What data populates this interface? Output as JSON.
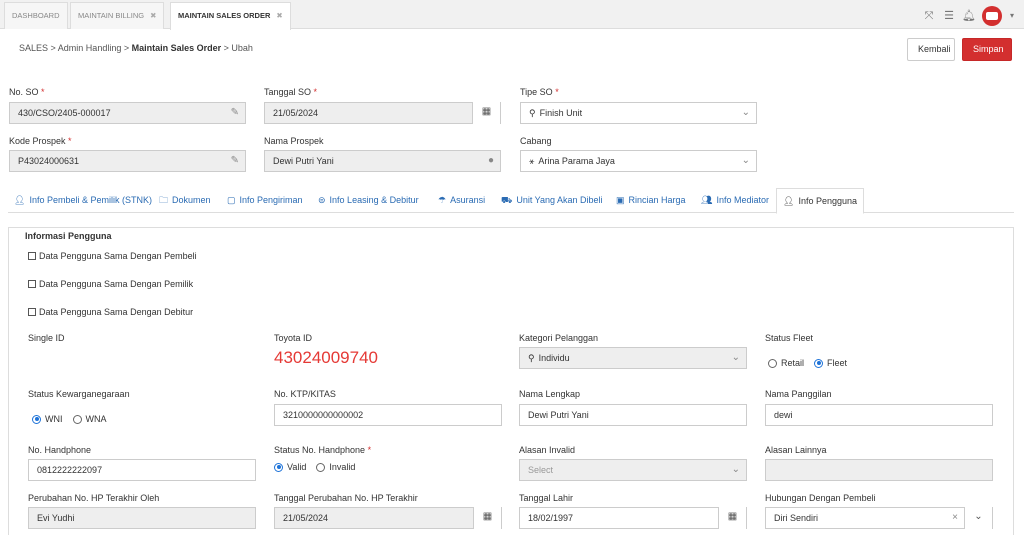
{
  "tabs": [
    {
      "label": "DASHBOARD"
    },
    {
      "label": "MAINTAIN BILLING"
    },
    {
      "label": "MAINTAIN SALES ORDER"
    }
  ],
  "breadcrumb": {
    "part1": "SALES",
    "part2": "Admin Handling",
    "part3": "Maintain Sales Order",
    "part4": "Ubah"
  },
  "actions": {
    "back": "Kembali",
    "save": "Simpan"
  },
  "header": {
    "no_so": {
      "label": "No. SO",
      "value": "430/CSO/2405-000017"
    },
    "tanggal_so": {
      "label": "Tanggal SO",
      "value": "21/05/2024"
    },
    "tipe_so": {
      "label": "Tipe SO",
      "value": "Finish Unit"
    },
    "kode_prospek": {
      "label": "Kode Prospek",
      "value": "P43024000631"
    },
    "nama_prospek": {
      "label": "Nama Prospek",
      "value": "Dewi Putri Yani"
    },
    "cabang": {
      "label": "Cabang",
      "value": "Arina Parama Jaya"
    }
  },
  "navtabs": [
    {
      "label": "Info Pembeli & Pemilik (STNK)",
      "icon": "user-icon"
    },
    {
      "label": "Dokumen",
      "icon": "folder-icon"
    },
    {
      "label": "Info Pengiriman",
      "icon": "map-icon"
    },
    {
      "label": "Info Leasing & Debitur",
      "icon": "money-icon"
    },
    {
      "label": "Asuransi",
      "icon": "umbrella-icon"
    },
    {
      "label": "Unit Yang Akan Dibeli",
      "icon": "car-icon"
    },
    {
      "label": "Rincian Harga",
      "icon": "price-icon"
    },
    {
      "label": "Info Mediator",
      "icon": "users-icon"
    },
    {
      "label": "Info Pengguna",
      "icon": "user-icon"
    }
  ],
  "section": {
    "title": "Informasi Pengguna"
  },
  "checkboxes": [
    {
      "label": "Data Pengguna Sama Dengan Pembeli",
      "checked": false
    },
    {
      "label": "Data Pengguna Sama Dengan Pemilik",
      "checked": false
    },
    {
      "label": "Data Pengguna Sama Dengan Debitur",
      "checked": false
    }
  ],
  "form": {
    "single_id": {
      "label": "Single ID"
    },
    "toyota_id": {
      "label": "Toyota ID",
      "value": "43024009740"
    },
    "kategori": {
      "label": "Kategori Pelanggan",
      "value": "Individu"
    },
    "status_fleet": {
      "label": "Status Fleet",
      "opt1": "Retail",
      "opt2": "Fleet",
      "selected": "Fleet"
    },
    "kewarganegaraan": {
      "label": "Status Kewarganegaraan",
      "opt1": "WNI",
      "opt2": "WNA",
      "selected": "WNI"
    },
    "ktp": {
      "label": "No. KTP/KITAS",
      "value": "3210000000000002"
    },
    "nama_lengkap": {
      "label": "Nama Lengkap",
      "value": "Dewi Putri Yani"
    },
    "nama_panggilan": {
      "label": "Nama Panggilan",
      "value": "dewi"
    },
    "handphone": {
      "label": "No. Handphone",
      "value": "0812222222097"
    },
    "status_hp": {
      "label": "Status No. Handphone",
      "opt1": "Valid",
      "opt2": "Invalid",
      "selected": "Valid"
    },
    "alasan_invalid": {
      "label": "Alasan Invalid",
      "placeholder": "Select"
    },
    "alasan_lainnya": {
      "label": "Alasan Lainnya"
    },
    "perubahan_oleh": {
      "label": "Perubahan No. HP Terakhir Oleh",
      "value": "Evi Yudhi"
    },
    "tanggal_perubahan": {
      "label": "Tanggal Perubahan No. HP Terakhir",
      "value": "21/05/2024"
    },
    "tanggal_lahir": {
      "label": "Tanggal Lahir",
      "value": "18/02/1997"
    },
    "hubungan": {
      "label": "Hubungan Dengan Pembeli",
      "value": "Diri Sendiri"
    }
  },
  "colors": {
    "accent": "#d32f2f",
    "link": "#2a6bb3",
    "radio": "#1e73d8"
  }
}
